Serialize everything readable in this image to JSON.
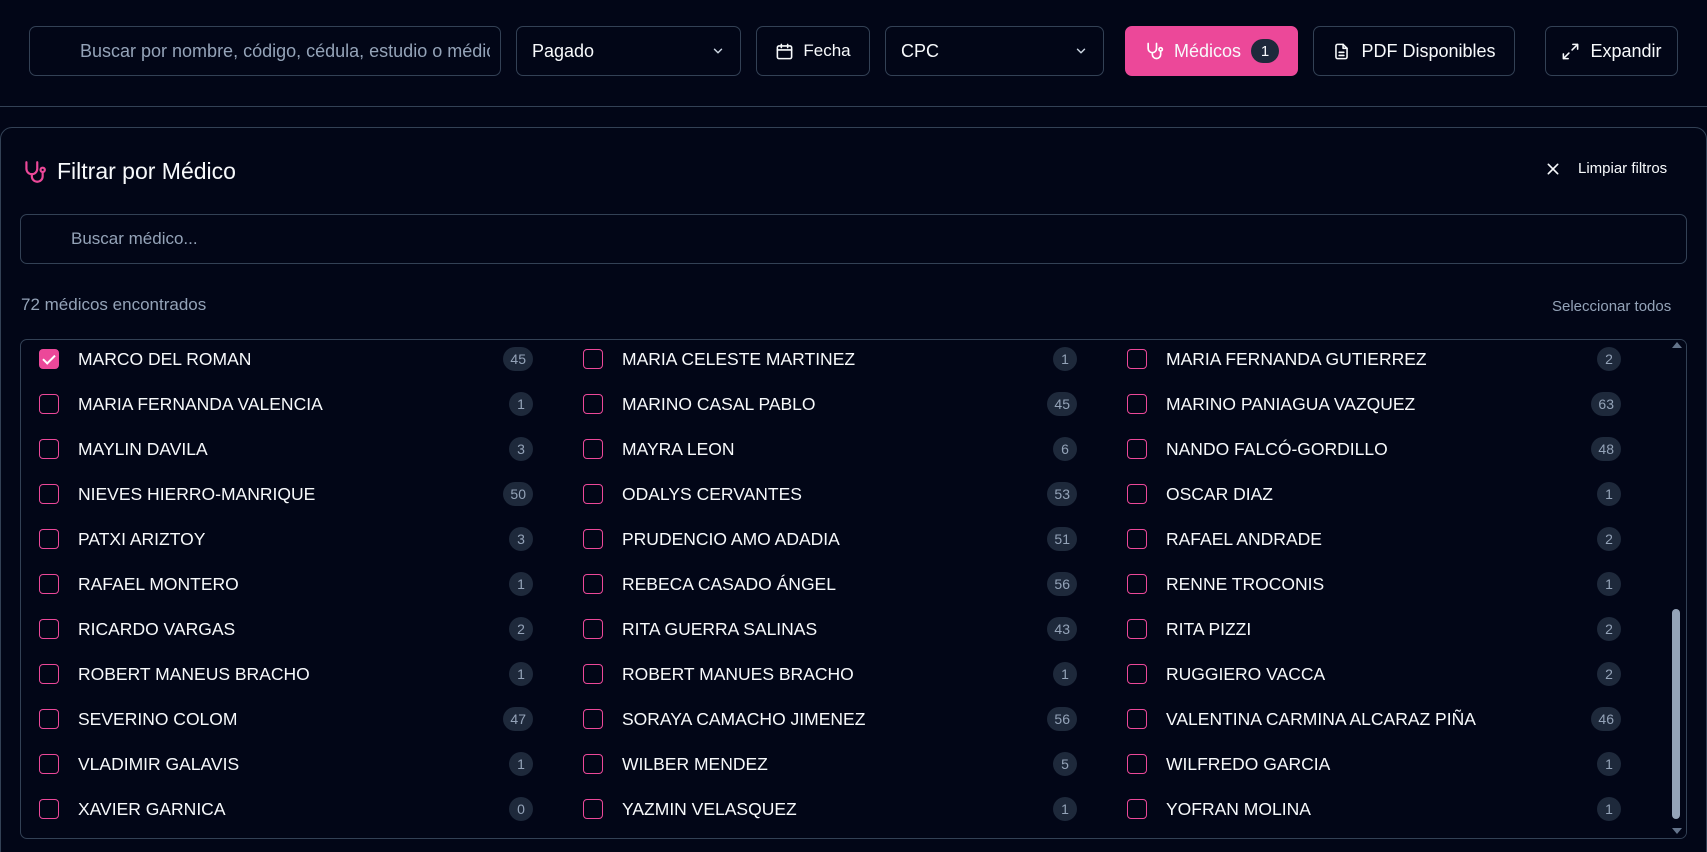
{
  "toolbar": {
    "search_placeholder": "Buscar por nombre, código, cédula, estudio o médico",
    "status_select": "Pagado",
    "date_label": "Fecha",
    "branch_select": "CPC",
    "medicos_label": "Médicos",
    "medicos_count": "1",
    "pdf_label": "PDF Disponibles",
    "expand_label": "Expandir"
  },
  "filter_panel": {
    "title": "Filtrar por Médico",
    "clear_label": "Limpiar filtros",
    "search_placeholder": "Buscar médico...",
    "found_text": "72 médicos encontrados",
    "select_all_label": "Seleccionar todos"
  },
  "colors": {
    "accent": "#ec4899",
    "background": "#020617",
    "border": "#334155",
    "badge": "#1e293b"
  },
  "doctors": [
    {
      "name": "MARCO DEL ROMAN",
      "count": "45",
      "checked": true
    },
    {
      "name": "MARIA CELESTE MARTINEZ",
      "count": "1",
      "checked": false
    },
    {
      "name": "MARIA FERNANDA GUTIERREZ",
      "count": "2",
      "checked": false
    },
    {
      "name": "MARIA FERNANDA VALENCIA",
      "count": "1",
      "checked": false
    },
    {
      "name": "MARINO CASAL PABLO",
      "count": "45",
      "checked": false
    },
    {
      "name": "MARINO PANIAGUA VAZQUEZ",
      "count": "63",
      "checked": false
    },
    {
      "name": "MAYLIN DAVILA",
      "count": "3",
      "checked": false
    },
    {
      "name": "MAYRA LEON",
      "count": "6",
      "checked": false
    },
    {
      "name": "NANDO FALCÓ-GORDILLO",
      "count": "48",
      "checked": false
    },
    {
      "name": "NIEVES HIERRO-MANRIQUE",
      "count": "50",
      "checked": false
    },
    {
      "name": "ODALYS CERVANTES",
      "count": "53",
      "checked": false
    },
    {
      "name": "OSCAR DIAZ",
      "count": "1",
      "checked": false
    },
    {
      "name": "PATXI ARIZTOY",
      "count": "3",
      "checked": false
    },
    {
      "name": "PRUDENCIO AMO ADADIA",
      "count": "51",
      "checked": false
    },
    {
      "name": "RAFAEL ANDRADE",
      "count": "2",
      "checked": false
    },
    {
      "name": "RAFAEL MONTERO",
      "count": "1",
      "checked": false
    },
    {
      "name": "REBECA CASADO ÁNGEL",
      "count": "56",
      "checked": false
    },
    {
      "name": "RENNE TROCONIS",
      "count": "1",
      "checked": false
    },
    {
      "name": "RICARDO VARGAS",
      "count": "2",
      "checked": false
    },
    {
      "name": "RITA GUERRA SALINAS",
      "count": "43",
      "checked": false
    },
    {
      "name": "RITA PIZZI",
      "count": "2",
      "checked": false
    },
    {
      "name": "ROBERT MANEUS BRACHO",
      "count": "1",
      "checked": false
    },
    {
      "name": "ROBERT MANUES BRACHO",
      "count": "1",
      "checked": false
    },
    {
      "name": "RUGGIERO VACCA",
      "count": "2",
      "checked": false
    },
    {
      "name": "SEVERINO COLOM",
      "count": "47",
      "checked": false
    },
    {
      "name": "SORAYA CAMACHO JIMENEZ",
      "count": "56",
      "checked": false
    },
    {
      "name": "VALENTINA CARMINA ALCARAZ PIÑA",
      "count": "46",
      "checked": false
    },
    {
      "name": "VLADIMIR GALAVIS",
      "count": "1",
      "checked": false
    },
    {
      "name": "WILBER MENDEZ",
      "count": "5",
      "checked": false
    },
    {
      "name": "WILFREDO GARCIA",
      "count": "1",
      "checked": false
    },
    {
      "name": "XAVIER GARNICA",
      "count": "0",
      "checked": false
    },
    {
      "name": "YAZMIN VELASQUEZ",
      "count": "1",
      "checked": false
    },
    {
      "name": "YOFRAN MOLINA",
      "count": "1",
      "checked": false
    }
  ]
}
